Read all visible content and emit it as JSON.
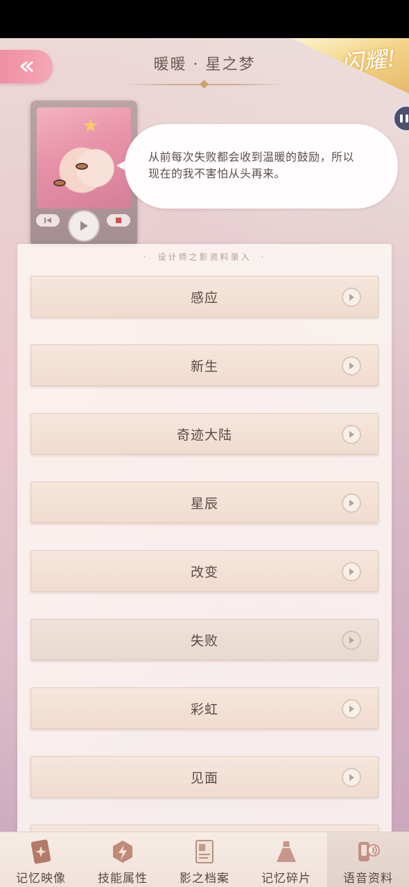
{
  "header": {
    "title": "暖暖 · 星之梦",
    "badge": "闪耀!"
  },
  "quote": {
    "line1": "从前每次失败都会收到温暖的鼓励，所以",
    "line2": "现在的我不害怕从头再来。"
  },
  "panel": {
    "title": "设计师之影资料录入"
  },
  "voice_lines": [
    {
      "label": "感应"
    },
    {
      "label": "新生"
    },
    {
      "label": "奇迹大陆"
    },
    {
      "label": "星辰"
    },
    {
      "label": "改变"
    },
    {
      "label": "失败"
    },
    {
      "label": "彩虹"
    },
    {
      "label": "见面"
    }
  ],
  "nav": {
    "tabs": [
      {
        "label": "记忆映像",
        "icon": "memory-image-icon"
      },
      {
        "label": "技能属性",
        "icon": "skill-icon"
      },
      {
        "label": "影之档案",
        "icon": "archive-icon"
      },
      {
        "label": "记忆碎片",
        "icon": "dress-icon"
      },
      {
        "label": "语音资料",
        "icon": "voice-icon"
      }
    ],
    "active_index": 4
  },
  "colors": {
    "accent_pink": "#ef8fa3",
    "gold": "#e7b968",
    "text": "#5a4a46"
  }
}
